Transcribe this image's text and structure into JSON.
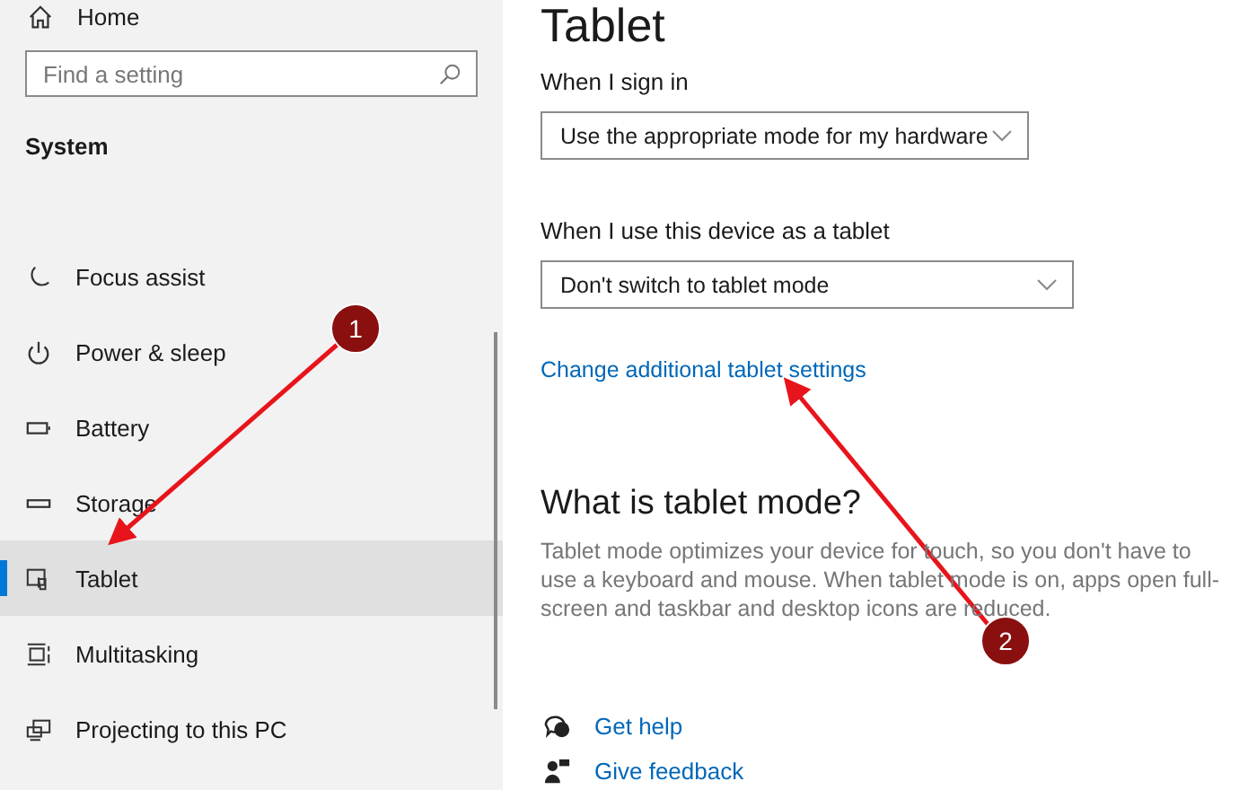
{
  "sidebar": {
    "home": "Home",
    "search": {
      "placeholder": "Find a setting"
    },
    "section": "System",
    "items": [
      {
        "label": "Focus assist",
        "selected": false
      },
      {
        "label": "Power & sleep",
        "selected": false
      },
      {
        "label": "Battery",
        "selected": false
      },
      {
        "label": "Storage",
        "selected": false
      },
      {
        "label": "Tablet",
        "selected": true
      },
      {
        "label": "Multitasking",
        "selected": false
      },
      {
        "label": "Projecting to this PC",
        "selected": false
      }
    ]
  },
  "main": {
    "title": "Tablet",
    "settings": [
      {
        "label": "When I sign in",
        "value": "Use the appropriate mode for my hardware"
      },
      {
        "label": "When I use this device as a tablet",
        "value": "Don't switch to tablet mode"
      }
    ],
    "link": "Change additional tablet settings",
    "info": {
      "heading": "What is tablet mode?",
      "text": "Tablet mode optimizes your device for touch, so you don't have to use a keyboard and mouse. When tablet mode is on, apps open full-screen and taskbar and desktop icons are reduced."
    },
    "help_links": [
      "Get help",
      "Give feedback"
    ]
  },
  "annotations": [
    {
      "label": "1"
    },
    {
      "label": "2"
    }
  ]
}
